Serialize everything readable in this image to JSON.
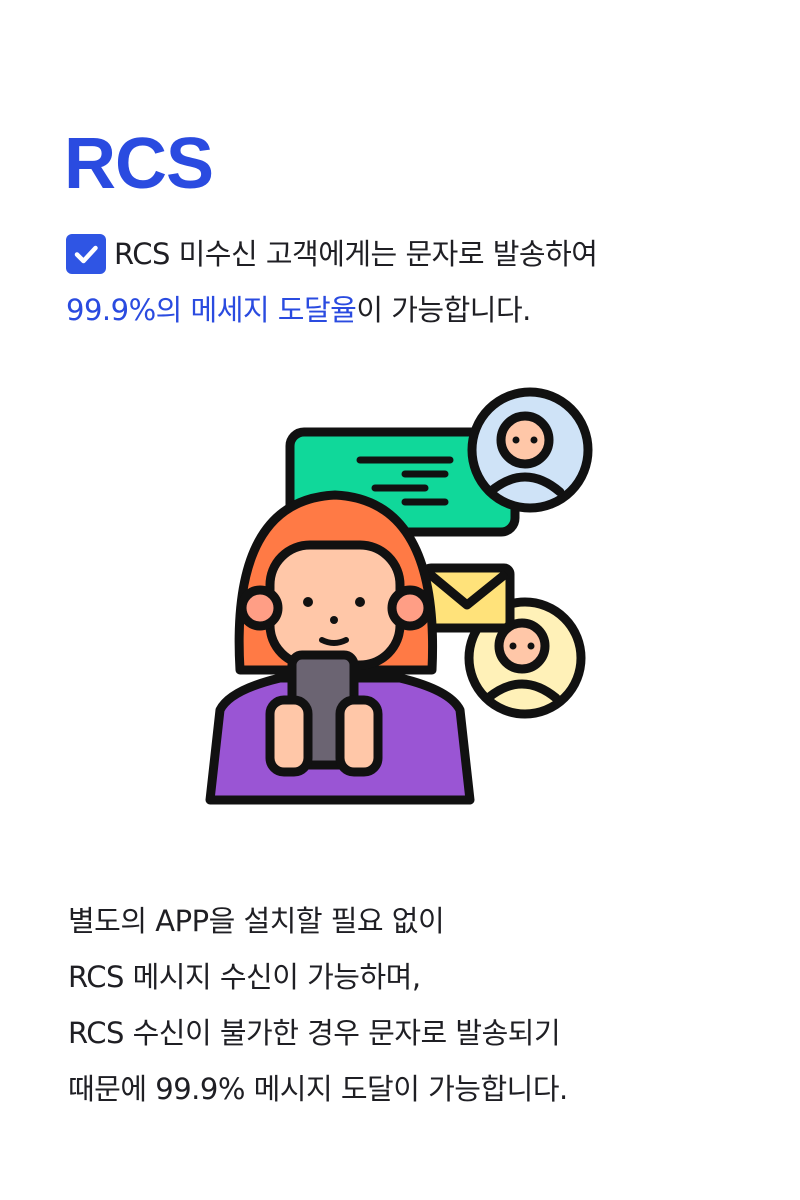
{
  "title": "RCS",
  "intro": {
    "line1": "RCS 미수신 고객에게는 문자로 발송하여",
    "line2_highlight": "99.9%의 메세지 도달율",
    "line2_rest": "이 가능합니다."
  },
  "body_lines": [
    "별도의 APP을 설치할 필요 없이",
    "RCS 메시지 수신이 가능하며,",
    "RCS 수신이 불가한 경우 문자로 발송되기",
    "때문에 99.9% 메시지 도달이 가능합니다."
  ],
  "colors": {
    "accent": "#2a4be0",
    "check_bg": "#2f55e4",
    "bubble_green": "#10d89a",
    "hair_orange": "#ff7a45",
    "shirt_purple": "#9a55d4",
    "skin": "#ffc7a8",
    "envelope": "#ffe27a",
    "avatar_blue": "#cfe3f7",
    "avatar_yellow": "#fff1b8"
  },
  "icons": [
    "check-icon",
    "person-with-phone-illustration",
    "chat-bubble-icon",
    "envelope-icon",
    "user-avatar-icon"
  ]
}
